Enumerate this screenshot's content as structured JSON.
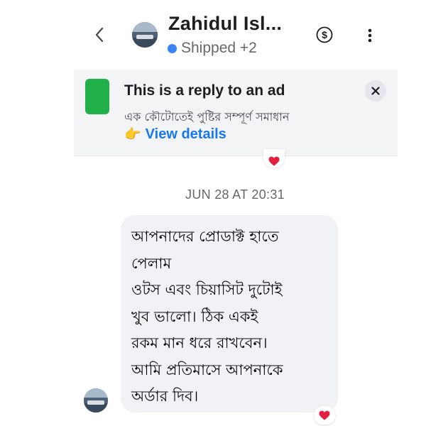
{
  "header": {
    "contact_name": "Zahidul Isl...",
    "status_label": "Shipped +2",
    "status_color": "#3b82f6",
    "icons": {
      "back": "chevron-left-icon",
      "payment": "dollar-circle-icon",
      "more": "vertical-dots-icon"
    }
  },
  "ad_banner": {
    "title": "This is a reply to an ad",
    "subtitle": "এক কৌটোতেই পুষ্টির সম্পূর্ণ সমাধান",
    "link_emoji": "👉",
    "link_label": "View details",
    "thumbnail_color": "#22b04b",
    "link_color": "#1877f2"
  },
  "conversation": {
    "timestamp": "JUN 28 AT 20:31",
    "message": {
      "lines": [
        "আপনাদের প্রোডাক্ট হাতে",
        "পেলাম",
        "ওটস এবং চিয়াসিট দুটোই",
        "খুব ভালো। ঠিক একই",
        "রকম মান ধরে রাখবেন।",
        "আমি প্রতিমাসে আপনাকে",
        "অর্ডার দিব।"
      ],
      "reaction": "heart"
    },
    "previous_reaction": "heart",
    "reaction_color": "#e41e3f"
  }
}
